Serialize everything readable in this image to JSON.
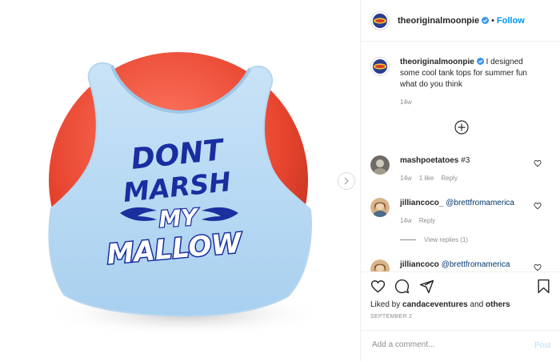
{
  "colors": {
    "accent": "#0095f6",
    "muted": "#8e8e8e",
    "text": "#262626",
    "mention": "#00376b",
    "post_disabled": "#b2dffc"
  },
  "post": {
    "image_text": [
      "DONT",
      "MARSH",
      "MY",
      "MALLOW"
    ]
  },
  "header": {
    "username": "theoriginalmoonpie",
    "separator": "•",
    "follow_label": "Follow"
  },
  "caption": {
    "username": "theoriginalmoonpie",
    "text": "I designed some cool tank tops for summer fun what do you think",
    "time": "14w"
  },
  "comments": [
    {
      "username": "mashpoetatoes",
      "text": "#3",
      "time": "14w",
      "likes": "1 like",
      "reply": "Reply"
    },
    {
      "username": "jilliancoco_",
      "mention": "@brettfromamerica",
      "time": "14w",
      "reply": "Reply",
      "view_replies": "View replies (1)"
    },
    {
      "username": "jilliancoco",
      "mention": "@brettfromamerica"
    }
  ],
  "footer": {
    "liked_prefix": "Liked by",
    "liked_user": "candaceventures",
    "liked_and": "and",
    "liked_others": "others",
    "date": "SEPTEMBER 2",
    "comment_placeholder": "Add a comment...",
    "post_label": "Post"
  },
  "icons": [
    "chevron-right-icon",
    "verified-badge-icon",
    "add-comment-icon",
    "heart-icon",
    "comment-icon",
    "share-icon",
    "bookmark-icon"
  ]
}
